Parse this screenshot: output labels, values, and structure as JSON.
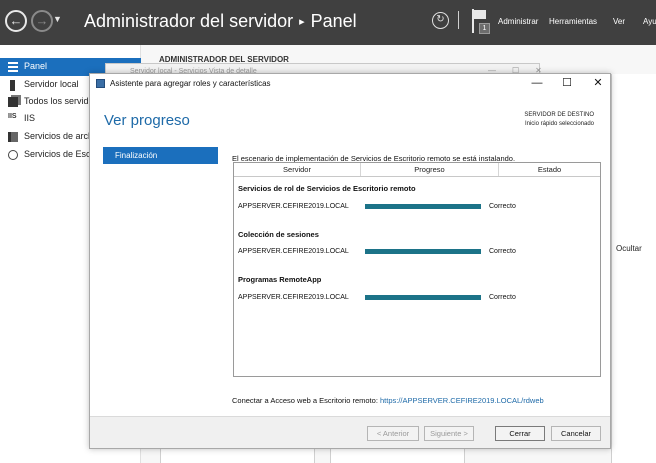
{
  "server_manager": {
    "title": "Administrador del servidor",
    "separator": "▸",
    "section": "Panel",
    "menu": [
      "Administrar",
      "Herramientas",
      "Ver",
      "Ayu"
    ],
    "notification_count": "1"
  },
  "sidebar": {
    "items": [
      {
        "label": "Panel",
        "icon": "dashboard-icon"
      },
      {
        "label": "Servidor local",
        "icon": "server-icon"
      },
      {
        "label": "Todos los servid",
        "icon": "all-servers-icon"
      },
      {
        "label": "IIS",
        "icon": "iis-icon"
      },
      {
        "label": "Servicios de arch",
        "icon": "file-services-icon"
      },
      {
        "label": "Servicios de Esc",
        "icon": "remote-desktop-icon"
      }
    ],
    "iis_icon_text": "IIS"
  },
  "background": {
    "header": "ADMINISTRADOR DEL SERVIDOR",
    "window_title": "Servidor local - Servicios Vista de detalle",
    "hide_label": "Ocultar"
  },
  "wizard": {
    "title": "Asistente para agregar roles y características",
    "controls": {
      "minimize": "—",
      "maximize": "☐",
      "close": "✕"
    },
    "heading": "Ver progreso",
    "destination_label": "SERVIDOR DE DESTINO",
    "destination_value": "Inicio rápido seleccionado",
    "step": "Finalización",
    "intro": "El escenario de implementación de Servicios de Escritorio remoto se está instalando.",
    "columns": [
      "Servidor",
      "Progreso",
      "Estado"
    ],
    "groups": [
      {
        "title": "Servicios de rol de Servicios de Escritorio remoto",
        "rows": [
          {
            "server": "APPSERVER.CEFIRE2019.LOCAL",
            "progress": 1.0,
            "status": "Correcto"
          }
        ]
      },
      {
        "title": "Colección de sesiones",
        "rows": [
          {
            "server": "APPSERVER.CEFIRE2019.LOCAL",
            "progress": 1.0,
            "status": "Correcto"
          }
        ]
      },
      {
        "title": "Programas RemoteApp",
        "rows": [
          {
            "server": "APPSERVER.CEFIRE2019.LOCAL",
            "progress": 1.0,
            "status": "Correcto"
          }
        ]
      }
    ],
    "link_prefix": "Conectar a Acceso web a Escritorio remoto: ",
    "link_url": "https://APPSERVER.CEFIRE2019.LOCAL/rdweb",
    "buttons": {
      "previous": "< Anterior",
      "next": "Siguiente >",
      "close": "Cerrar",
      "cancel": "Cancelar"
    }
  },
  "colors": {
    "accent": "#1b6fbd",
    "progress": "#1c7388",
    "titlebar": "#404040",
    "heading": "#1e6aa8"
  }
}
